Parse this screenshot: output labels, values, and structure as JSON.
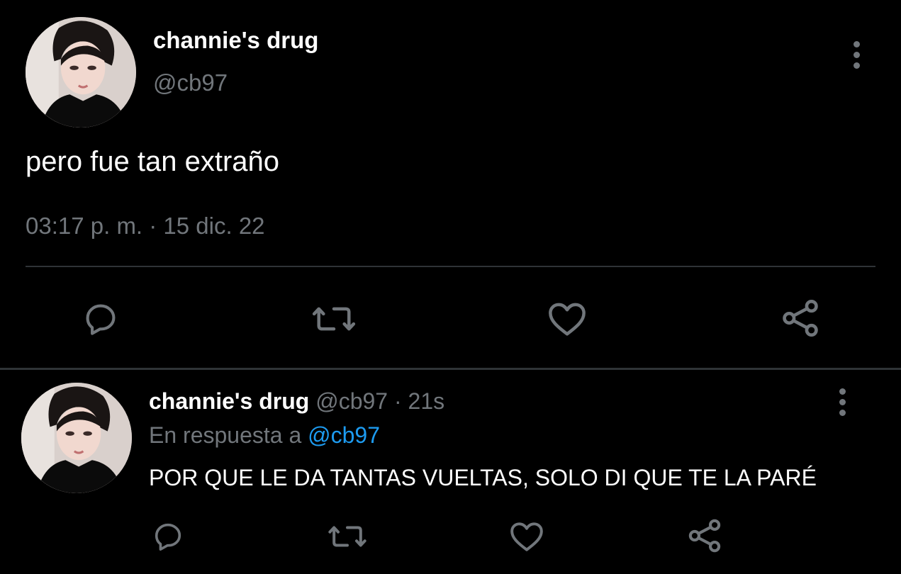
{
  "main_tweet": {
    "display_name": "channie's drug",
    "handle": "@cb97",
    "text": "pero fue tan extraño",
    "timestamp": "03:17 p. m. · 15 dic. 22",
    "avatar_icon": "profile-photo",
    "actions": [
      "reply-icon",
      "retweet-icon",
      "like-icon",
      "share-icon"
    ]
  },
  "reply_tweet": {
    "display_name": "channie's drug",
    "handle": "@cb97",
    "separator": " · ",
    "age": "21s",
    "in_reply_prefix": "En respuesta a ",
    "in_reply_mention": "@cb97",
    "text": "POR QUE LE DA TANTAS VUELTAS, SOLO DI QUE TE LA PARÉ",
    "avatar_icon": "profile-photo",
    "actions": [
      "reply-icon",
      "retweet-icon",
      "like-icon",
      "share-icon"
    ]
  },
  "colors": {
    "background": "#000000",
    "primary_text": "#ffffff",
    "secondary_text": "#71767b",
    "divider": "#2f3336",
    "link": "#1d9bf0"
  }
}
